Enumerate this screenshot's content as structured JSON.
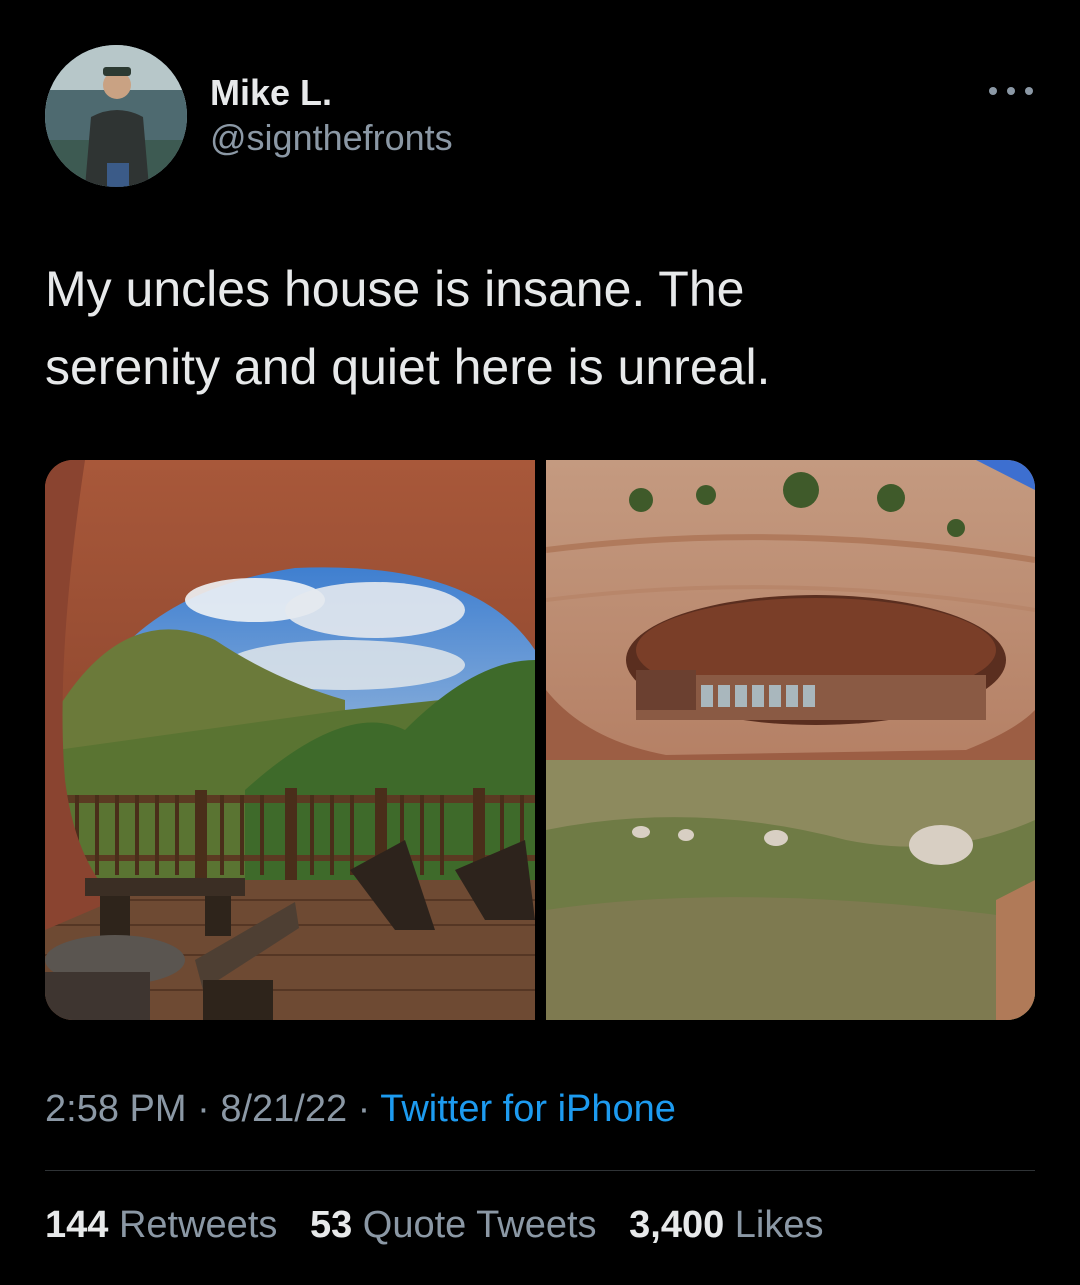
{
  "author": {
    "display_name": "Mike L.",
    "handle": "@signthefronts",
    "avatar_icon": "profile-photo",
    "more_icon": "ellipsis-icon"
  },
  "tweet": {
    "text": "My uncles house is insane. The\nserenity and quiet here is unreal."
  },
  "media": {
    "photo_1": "photo of a covered wooden deck with railing and chairs inside a sandstone cave overlooking a green valley",
    "photo_2": "photo of a house built into a large sandstone cliff alcove above a grassy field"
  },
  "meta": {
    "time": "2:58 PM",
    "sep1": " · ",
    "date": "8/21/22",
    "sep2": " · ",
    "source": "Twitter for iPhone"
  },
  "stats": {
    "retweets_count": "144",
    "retweets_label": "Retweets",
    "quotes_count": "53",
    "quotes_label": "Quote Tweets",
    "likes_count": "3,400",
    "likes_label": "Likes"
  },
  "colors": {
    "background": "#000000",
    "primary_text": "#e7e9ea",
    "secondary_text": "#8b98a5",
    "link": "#1d9bf0",
    "divider": "#2f3336"
  }
}
